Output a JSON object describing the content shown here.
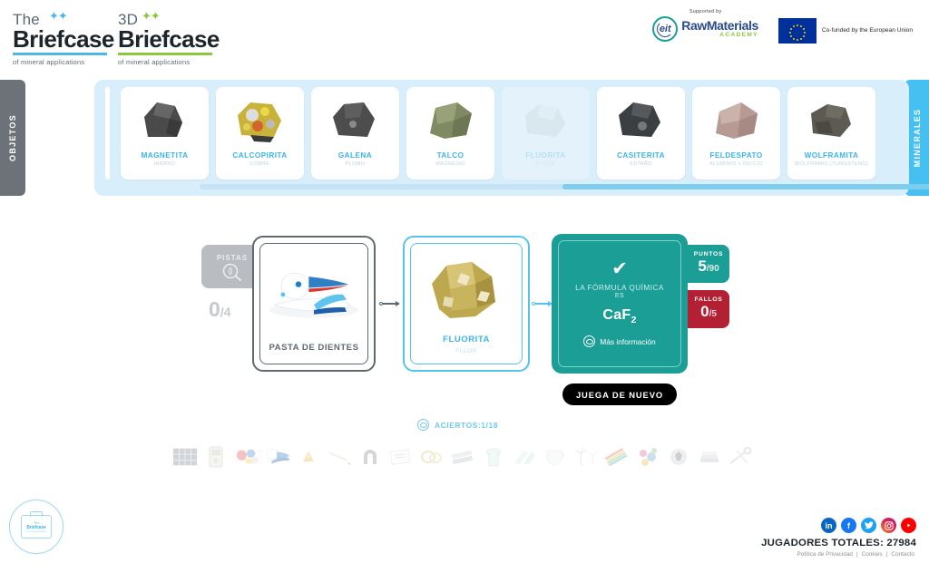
{
  "header": {
    "logos": [
      {
        "top": "The",
        "main": "Briefcase",
        "sub": "of mineral applications",
        "accent": "#4db7e8"
      },
      {
        "top": "3D",
        "main": "Briefcase",
        "sub": "of mineral applications",
        "accent": "#8cc63f"
      }
    ],
    "sponsors": {
      "supported_by": "Supported by",
      "eit_mark": "eit",
      "rawmaterials": "RawMaterials",
      "academy": "ACADEMY",
      "eu_text": "Co-funded by the European Union"
    }
  },
  "tabs": {
    "left_label": "OBJETOS",
    "right_label": "MINERALES"
  },
  "minerals": [
    {
      "name": "MAGNETITA",
      "sub": "HIERRO",
      "used": false
    },
    {
      "name": "CALCOPIRITA",
      "sub": "COBRE",
      "used": false
    },
    {
      "name": "GALENA",
      "sub": "PLOMO",
      "used": false
    },
    {
      "name": "TALCO",
      "sub": "MAGNESIO",
      "used": false
    },
    {
      "name": "FLUORITA",
      "sub": "FLÚOR",
      "used": true
    },
    {
      "name": "CASITERITA",
      "sub": "ESTAÑO",
      "used": false
    },
    {
      "name": "FELDESPATO",
      "sub": "ALUMINIO + SILICIO",
      "used": false
    },
    {
      "name": "WOLFRAMITA",
      "sub": "WOLFRAMIO (TUNGSTENO)",
      "used": false
    }
  ],
  "game": {
    "hints_label": "PISTAS",
    "hints_used": "0",
    "hints_total": "/4",
    "object_card": {
      "caption": "PASTA DE DIENTES"
    },
    "mineral_card": {
      "caption": "FLUORITA",
      "sub": "FLÚOR"
    },
    "result": {
      "check": "✔",
      "line1": "LA FÓRMULA QUÍMICA",
      "line2": "ES",
      "formula_main": "CaF",
      "formula_sub": "2",
      "more_info": "Más información"
    },
    "points": {
      "label": "PUNTOS",
      "value": "5",
      "total": "/90"
    },
    "fails": {
      "label": "FALLOS",
      "value": "0",
      "total": "/5"
    },
    "replay_button": "JUEGA DE NUEVO",
    "score_text": "ACIERTOS:1/18"
  },
  "footer": {
    "badge": {
      "line1": "The",
      "line2": "Briefcase",
      "line3": "of mineral applications"
    },
    "socials": [
      "in",
      "f",
      "t",
      "ig",
      "yt"
    ],
    "players": "JUGADORES TOTALES: 27984",
    "links": [
      "Política de Privacidad",
      "Cookies",
      "Contacto"
    ],
    "separator": "|"
  }
}
